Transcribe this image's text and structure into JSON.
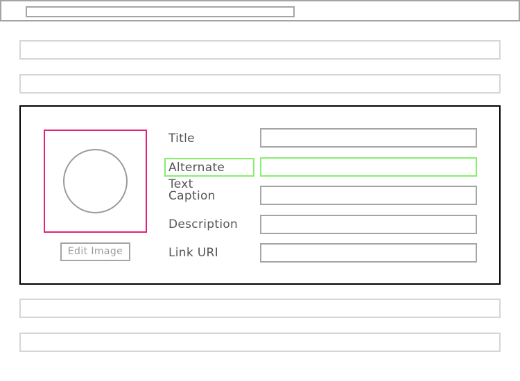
{
  "browser": {
    "url_value": ""
  },
  "media_form": {
    "edit_image_label": "Edit Image",
    "fields": [
      {
        "label": "Title",
        "value": ""
      },
      {
        "label": "Alternate Text",
        "value": ""
      },
      {
        "label": "Caption",
        "value": ""
      },
      {
        "label": "Description",
        "value": ""
      },
      {
        "label": "Link URI",
        "value": ""
      }
    ]
  },
  "colors": {
    "image_frame": "#e0227c",
    "focus_highlight": "#86ee6c",
    "panel_border": "#000000",
    "placeholder_border": "#d6d6d6"
  },
  "icons": {
    "image_placeholder": "circle-image-placeholder-icon"
  }
}
